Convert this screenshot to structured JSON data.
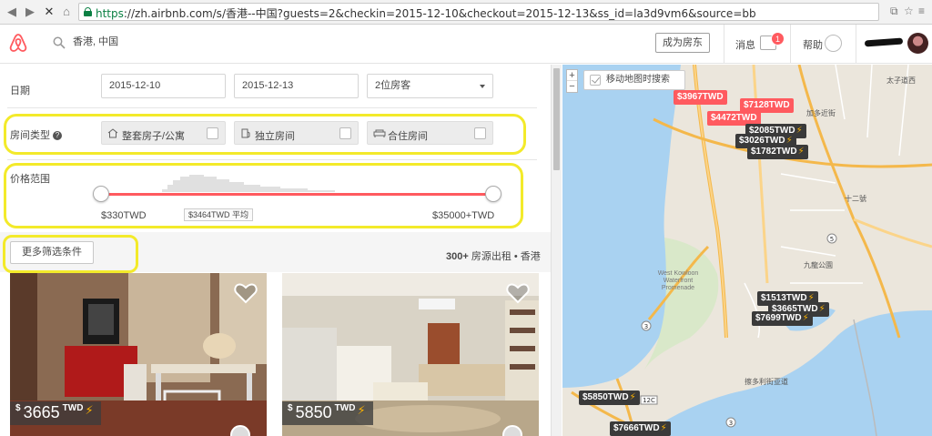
{
  "browser": {
    "url_scheme": "https",
    "url_rest": "://zh.airbnb.com/s/香港--中国?guests=2&checkin=2015-12-10&checkout=2015-12-13&ss_id=la3d9vm6&source=bb"
  },
  "header": {
    "search_value": "香港, 中国",
    "host_button": "成为房东",
    "messages_label": "消息",
    "messages_badge": "1",
    "help_label": "帮助"
  },
  "filters": {
    "dates_label": "日期",
    "checkin": "2015-12-10",
    "checkout": "2015-12-13",
    "guests": "2位房客",
    "room_type_label": "房间类型",
    "room_types": [
      {
        "label": "整套房子/公寓",
        "icon": "house-icon"
      },
      {
        "label": "独立房间",
        "icon": "door-icon"
      },
      {
        "label": "合住房间",
        "icon": "sofa-icon"
      }
    ],
    "price_label": "价格范围",
    "price_min": "$330TWD",
    "price_max": "$35000+TWD",
    "price_avg": "$3464TWD 平均",
    "more_filters": "更多筛选条件",
    "results_count_bold": "300+",
    "results_count_text": " 房源出租 • 香港"
  },
  "listings": [
    {
      "currency": "$",
      "amount": "3665",
      "ccy": "TWD"
    },
    {
      "currency": "$",
      "amount": "5850",
      "ccy": "TWD"
    }
  ],
  "map": {
    "zoom_in": "+",
    "zoom_out": "−",
    "search_toggle": "移动地图时搜索",
    "pins": [
      {
        "text": "$3967TWD",
        "style": "red"
      },
      {
        "text": "$7128TWD",
        "style": "red"
      },
      {
        "text": "$4472TWD",
        "style": "red"
      },
      {
        "text": "$2085TWD",
        "style": "dark"
      },
      {
        "text": "$3026TWD",
        "style": "dark"
      },
      {
        "text": "$1782TWD",
        "style": "dark"
      },
      {
        "text": "$1513TWD",
        "style": "dark"
      },
      {
        "text": "$3665TWD",
        "style": "dark"
      },
      {
        "text": "$7699TWD",
        "style": "dark"
      },
      {
        "text": "$5850TWD",
        "style": "dark"
      },
      {
        "text": "$7666TWD",
        "style": "dark"
      }
    ],
    "labels": {
      "taizi": "太子道西",
      "wk_waterfront": "West Kowloon Waterfront Promenade",
      "wk_stop": "擦多利街亚道",
      "jiadeng": "加多近街",
      "shiyi": "十二號",
      "kowloon_park": "九龍公園"
    },
    "road_badges": [
      "3",
      "5",
      "3",
      "12C"
    ]
  }
}
